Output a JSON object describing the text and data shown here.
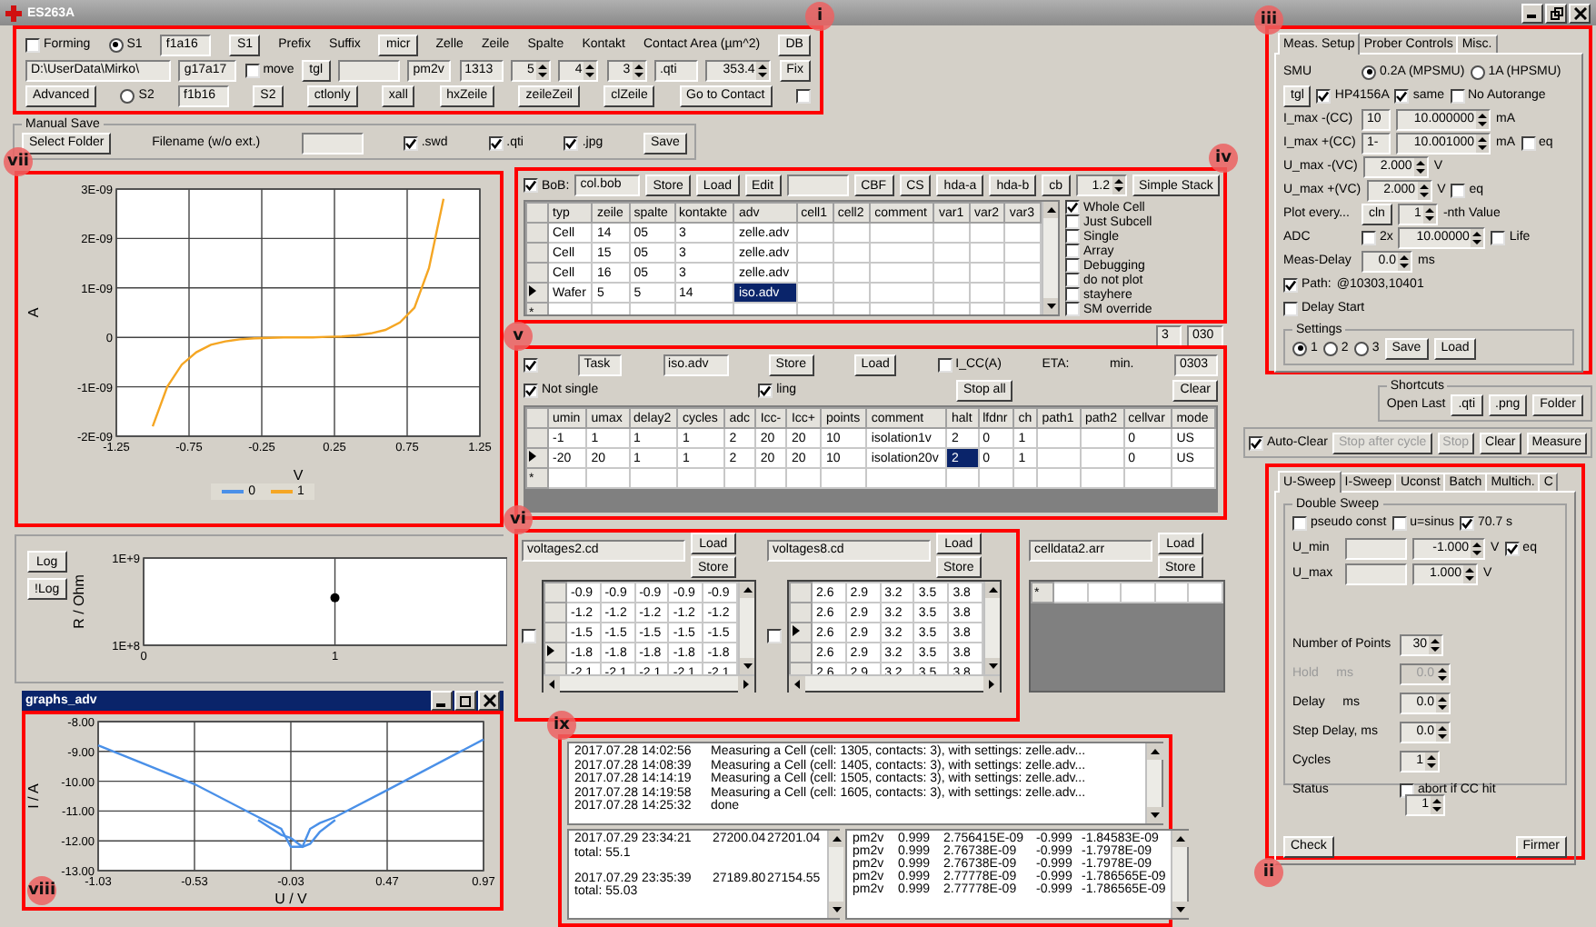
{
  "window": {
    "title": "ES263A"
  },
  "forming": {
    "annotation": "i",
    "rows": [
      {
        "items": [
          {
            "kind": "check",
            "text": "Forming",
            "checked": false
          },
          {
            "kind": "radio",
            "text": "S1",
            "selected": true
          },
          {
            "kind": "field",
            "value": "f1a16"
          },
          {
            "kind": "button",
            "text": "S1"
          },
          {
            "kind": "label",
            "text": "Prefix"
          },
          {
            "kind": "label",
            "text": "Suffix"
          },
          {
            "kind": "button",
            "text": "micr"
          },
          {
            "kind": "label",
            "text": "Zelle"
          },
          {
            "kind": "label",
            "text": "Zeile"
          },
          {
            "kind": "label",
            "text": "Spalte"
          },
          {
            "kind": "label",
            "text": "Kontakt"
          },
          {
            "kind": "label",
            "text": "Contact Area (µm^2)"
          },
          {
            "kind": "button",
            "text": "DB"
          }
        ]
      },
      {
        "items": [
          {
            "kind": "field",
            "value": "D:\\UserData\\Mirko\\"
          },
          {
            "kind": "field",
            "value": "g17a17"
          },
          {
            "kind": "check",
            "text": "move",
            "checked": false
          },
          {
            "kind": "button",
            "text": "tgl"
          },
          {
            "kind": "field"
          },
          {
            "kind": "field",
            "value": "pm2v"
          },
          {
            "kind": "field",
            "value": "1313"
          },
          {
            "kind": "spin",
            "value": "5"
          },
          {
            "kind": "spin",
            "value": "4"
          },
          {
            "kind": "spin",
            "value": "3"
          },
          {
            "kind": "field",
            "value": ".qti"
          },
          {
            "kind": "spin",
            "value": "353.4"
          },
          {
            "kind": "button",
            "text": "Fix"
          }
        ]
      },
      {
        "items": [
          {
            "kind": "button",
            "text": "Advanced"
          },
          {
            "kind": "radio",
            "text": "S2",
            "selected": false
          },
          {
            "kind": "field",
            "value": "f1b16"
          },
          {
            "kind": "button",
            "text": "S2"
          },
          {
            "kind": "button",
            "text": "ctlonly"
          },
          {
            "kind": "button",
            "text": "xall"
          },
          {
            "kind": "button",
            "text": "hxZeile"
          },
          {
            "kind": "button",
            "text": "zeileZeil"
          },
          {
            "kind": "button",
            "text": "clZeile"
          },
          {
            "kind": "button",
            "text": "Go to Contact"
          },
          {
            "kind": "check",
            "checked": false
          }
        ]
      }
    ]
  },
  "manual_save": {
    "title": "Manual Save",
    "items": [
      {
        "kind": "button",
        "text": "Select Folder"
      },
      {
        "kind": "label",
        "text": "Filename (w/o ext.)"
      },
      {
        "kind": "field"
      },
      {
        "kind": "check",
        "text": ".swd",
        "checked": true
      },
      {
        "kind": "check",
        "text": ".qti",
        "checked": true
      },
      {
        "kind": "check",
        "text": ".jpg",
        "checked": true
      },
      {
        "kind": "button",
        "text": "Save"
      }
    ]
  },
  "iv_curve": {
    "annotation": "vii",
    "chart_data": {
      "type": "line",
      "xlabel": "V",
      "ylabel": "A",
      "grid": true,
      "x": [
        -1,
        -0.9,
        -0.8,
        -0.7,
        -0.6,
        -0.5,
        -0.4,
        -0.3,
        -0.2,
        -0.1,
        0,
        0.1,
        0.2,
        0.3,
        0.4,
        0.5,
        0.6,
        0.7,
        0.8,
        0.9,
        1
      ],
      "xlim": [
        -1.25,
        1.25
      ],
      "ylim": [
        -2e-09,
        3e-09
      ],
      "xticks": [
        -1.25,
        -0.75,
        -0.25,
        0.25,
        0.75,
        1.25
      ],
      "yticks": [
        {
          "value": -2e-09,
          "label": "-2E-09"
        },
        {
          "value": -1e-09,
          "label": "-1E-09"
        },
        {
          "value": 0,
          "label": "0"
        },
        {
          "value": 1e-09,
          "label": "1E-09"
        },
        {
          "value": 2e-09,
          "label": "2E-09"
        },
        {
          "value": 3e-09,
          "label": "3E-09"
        }
      ],
      "series": [
        {
          "name": "0",
          "color": "#4a90e8",
          "values": [
            null,
            null,
            null,
            null,
            null,
            null,
            null,
            null,
            null,
            null,
            null,
            null,
            null,
            null,
            null,
            null,
            null,
            null,
            null,
            null,
            null
          ]
        },
        {
          "name": "1",
          "color": "#f5a623",
          "values": [
            -1.8e-09,
            -1e-09,
            -5.5e-10,
            -3e-10,
            -1.5e-10,
            -8e-11,
            -4e-11,
            -2e-11,
            -1e-11,
            0,
            0,
            0,
            1e-11,
            2e-11,
            4e-11,
            8e-11,
            1.5e-10,
            3e-10,
            6e-10,
            1.4e-09,
            2.8e-09
          ]
        }
      ]
    }
  },
  "resistance": {
    "buttons": [
      "Log",
      "!Log"
    ],
    "chart_data": {
      "type": "scatter",
      "ylabel": "R / Ohm",
      "grid": true,
      "x": [
        1
      ],
      "values": [
        590000000
      ],
      "xlim": [
        0,
        1.9
      ],
      "ylim": [
        100000000,
        1000000000
      ],
      "xticks": [
        0,
        1
      ],
      "yticks": [
        {
          "value": 100000000,
          "label": "1E+8"
        },
        {
          "value": 1000000000,
          "label": "1E+9"
        }
      ]
    }
  },
  "graphs_window": {
    "title": "graphs_adv",
    "annotation": "viii",
    "chart_data": {
      "type": "line",
      "xlabel": "U / V",
      "ylabel": "I / A",
      "grid": true,
      "x": [
        -1.03,
        -0.53,
        -0.2,
        -0.08,
        -0.03,
        0.03,
        0.07,
        0.12,
        0.2,
        0.47,
        0.97
      ],
      "xlim": [
        -1.03,
        0.97
      ],
      "ylim": [
        -13,
        -8
      ],
      "xticks": [
        -1.03,
        -0.53,
        -0.03,
        0.47,
        0.97
      ],
      "yticks": [
        {
          "value": -13,
          "label": "-13.00"
        },
        {
          "value": -12,
          "label": "-12.00"
        },
        {
          "value": -11,
          "label": "-11.00"
        },
        {
          "value": -10,
          "label": "-10.00"
        },
        {
          "value": -9,
          "label": "-9.00"
        },
        {
          "value": -8,
          "label": "-8.00"
        }
      ],
      "series": [
        {
          "color": "#4a90e8",
          "values": [
            -8.8,
            -10.1,
            -11.2,
            -11.6,
            -12.2,
            -12.2,
            -11.6,
            -11.4,
            -11.2,
            -10.3,
            -8.6
          ]
        },
        {
          "color": "#4a90e8",
          "values": [
            null,
            null,
            -11.3,
            -11.8,
            -11.9,
            -12.2,
            -12.1,
            -11.7,
            -11.3,
            null,
            null
          ]
        }
      ]
    }
  },
  "bob": {
    "annotation": "iv",
    "toolbar": [
      {
        "kind": "check",
        "text": "BoB:",
        "checked": true
      },
      {
        "kind": "field",
        "value": "col.bob"
      },
      {
        "kind": "button",
        "text": "Store"
      },
      {
        "kind": "button",
        "text": "Load"
      },
      {
        "kind": "button",
        "text": "Edit"
      },
      {
        "kind": "field"
      },
      {
        "kind": "button",
        "text": "CBF"
      },
      {
        "kind": "button",
        "text": "CS"
      },
      {
        "kind": "button",
        "text": "hda-a"
      },
      {
        "kind": "button",
        "text": "hda-b"
      },
      {
        "kind": "button",
        "text": "cb"
      },
      {
        "kind": "spin",
        "value": "1.2"
      },
      {
        "kind": "button",
        "text": "Simple Stack"
      }
    ],
    "table": {
      "columns": [
        "typ",
        "zeile",
        "spalte",
        "kontakte",
        "adv",
        "cell1",
        "cell2",
        "comment",
        "var1",
        "var2",
        "var3"
      ],
      "new_row_marker": "*",
      "rows": [
        {
          "current": false,
          "cells": [
            {
              "text": "Cell",
              "selected": false
            },
            {
              "text": "14",
              "selected": false
            },
            {
              "text": "05",
              "selected": false
            },
            {
              "text": "3",
              "selected": false
            },
            {
              "text": "zelle.adv",
              "selected": false
            },
            {
              "selected": false
            },
            {
              "selected": false
            },
            {
              "selected": false
            },
            {
              "selected": false
            },
            {
              "selected": false
            },
            {
              "selected": false
            }
          ]
        },
        {
          "current": false,
          "cells": [
            {
              "text": "Cell",
              "selected": false
            },
            {
              "text": "15",
              "selected": false
            },
            {
              "text": "05",
              "selected": false
            },
            {
              "text": "3",
              "selected": false
            },
            {
              "text": "zelle.adv",
              "selected": false
            },
            {
              "selected": false
            },
            {
              "selected": false
            },
            {
              "selected": false
            },
            {
              "selected": false
            },
            {
              "selected": false
            },
            {
              "selected": false
            }
          ]
        },
        {
          "current": false,
          "cells": [
            {
              "text": "Cell",
              "selected": false
            },
            {
              "text": "16",
              "selected": false
            },
            {
              "text": "05",
              "selected": false
            },
            {
              "text": "3",
              "selected": false
            },
            {
              "text": "zelle.adv",
              "selected": false
            },
            {
              "selected": false
            },
            {
              "selected": false
            },
            {
              "selected": false
            },
            {
              "selected": false
            },
            {
              "selected": false
            },
            {
              "selected": false
            }
          ]
        },
        {
          "current": true,
          "cells": [
            {
              "text": "Wafer",
              "selected": false
            },
            {
              "text": "5",
              "selected": false
            },
            {
              "text": "5",
              "selected": false
            },
            {
              "text": "14",
              "selected": false
            },
            {
              "text": "iso.adv",
              "selected": true
            },
            {
              "selected": false
            },
            {
              "selected": false
            },
            {
              "selected": false
            },
            {
              "selected": false
            },
            {
              "selected": false
            },
            {
              "selected": false
            }
          ]
        }
      ]
    },
    "options": [
      {
        "kind": "check",
        "text": "Whole Cell",
        "checked": true
      },
      {
        "kind": "check",
        "text": "Just Subcell",
        "checked": false
      },
      {
        "kind": "check",
        "text": "Single",
        "checked": false
      },
      {
        "kind": "check",
        "text": "Array",
        "checked": false
      },
      {
        "kind": "check",
        "text": "Debugging",
        "checked": false
      },
      {
        "kind": "check",
        "text": "do not plot",
        "checked": false
      },
      {
        "kind": "check",
        "text": "stayhere",
        "checked": false
      },
      {
        "kind": "check",
        "text": "SM override",
        "checked": false
      }
    ],
    "status": [
      {
        "kind": "field",
        "value": "3"
      },
      {
        "kind": "field",
        "value": "030"
      }
    ]
  },
  "task": {
    "annotation": "v",
    "rows": [
      {
        "items": [
          {
            "kind": "check",
            "checked": true
          },
          {
            "kind": "field",
            "value": "Task"
          },
          {
            "kind": "field",
            "value": "iso.adv"
          },
          {
            "kind": "button",
            "text": "Store"
          },
          {
            "kind": "button",
            "text": "Load"
          },
          {
            "kind": "check",
            "text": "I_CC(A)",
            "checked": false
          },
          {
            "kind": "label",
            "text": "ETA:"
          },
          {
            "kind": "label",
            "text": "min."
          },
          {
            "kind": "field",
            "value": "0303"
          }
        ]
      },
      {
        "items": [
          {
            "kind": "check",
            "text": "Not single",
            "checked": true
          },
          {
            "kind": "check",
            "text": "ling",
            "checked": true
          },
          {
            "kind": "button",
            "text": "Stop all"
          },
          {
            "kind": "button",
            "text": "Clear"
          }
        ]
      }
    ],
    "table": {
      "columns": [
        "umin",
        "umax",
        "delay2",
        "cycles",
        "adc",
        "Icc-",
        "Icc+",
        "points",
        "comment",
        "halt",
        "lfdnr",
        "ch",
        "path1",
        "path2",
        "cellvar",
        "mode"
      ],
      "new_row_marker": "*",
      "rows": [
        {
          "current": false,
          "cells": [
            {
              "text": "-1",
              "selected": false
            },
            {
              "text": "1",
              "selected": false
            },
            {
              "text": "1",
              "selected": false
            },
            {
              "text": "1",
              "selected": false
            },
            {
              "text": "2",
              "selected": false
            },
            {
              "text": "20",
              "selected": false
            },
            {
              "text": "20",
              "selected": false
            },
            {
              "text": "10",
              "selected": false
            },
            {
              "text": "isolation1v",
              "selected": false
            },
            {
              "text": "2",
              "selected": false
            },
            {
              "text": "0",
              "selected": false
            },
            {
              "text": "1",
              "selected": false
            },
            {
              "selected": false
            },
            {
              "selected": false
            },
            {
              "text": "0",
              "selected": false
            },
            {
              "text": "US",
              "selected": false
            }
          ]
        },
        {
          "current": true,
          "cells": [
            {
              "text": "-20",
              "selected": false
            },
            {
              "text": "20",
              "selected": false
            },
            {
              "text": "1",
              "selected": false
            },
            {
              "text": "1",
              "selected": false
            },
            {
              "text": "2",
              "selected": false
            },
            {
              "text": "20",
              "selected": false
            },
            {
              "text": "20",
              "selected": false
            },
            {
              "text": "10",
              "selected": false
            },
            {
              "text": "isolation20v",
              "selected": false
            },
            {
              "text": "2",
              "selected": true
            },
            {
              "text": "0",
              "selected": false
            },
            {
              "text": "1",
              "selected": false
            },
            {
              "selected": false
            },
            {
              "selected": false
            },
            {
              "text": "0",
              "selected": false
            },
            {
              "text": "US",
              "selected": false
            }
          ]
        }
      ]
    }
  },
  "voltages": {
    "annotation": "vi",
    "grids": [
      {
        "file": "voltages2.cd",
        "buttons": [
          "Load",
          "Store"
        ],
        "checked": false,
        "rows": [
          {
            "current": false,
            "cells": [
              "-0.9",
              "-0.9",
              "-0.9",
              "-0.9",
              "-0.9"
            ]
          },
          {
            "current": false,
            "cells": [
              "-1.2",
              "-1.2",
              "-1.2",
              "-1.2",
              "-1.2"
            ]
          },
          {
            "current": false,
            "cells": [
              "-1.5",
              "-1.5",
              "-1.5",
              "-1.5",
              "-1.5"
            ]
          },
          {
            "current": true,
            "cells": [
              "-1.8",
              "-1.8",
              "-1.8",
              "-1.8",
              "-1.8"
            ]
          },
          {
            "current": false,
            "cells": [
              "-2.1",
              "-2.1",
              "-2.1",
              "-2.1",
              "-2.1"
            ]
          }
        ]
      },
      {
        "file": "voltages8.cd",
        "buttons": [
          "Load",
          "Store"
        ],
        "checked": false,
        "rows": [
          {
            "current": false,
            "cells": [
              "2.6",
              "2.9",
              "3.2",
              "3.5",
              "3.8"
            ]
          },
          {
            "current": false,
            "cells": [
              "2.6",
              "2.9",
              "3.2",
              "3.5",
              "3.8"
            ]
          },
          {
            "current": true,
            "cells": [
              "2.6",
              "2.9",
              "3.2",
              "3.5",
              "3.8"
            ]
          },
          {
            "current": false,
            "cells": [
              "2.6",
              "2.9",
              "3.2",
              "3.5",
              "3.8"
            ]
          },
          {
            "current": false,
            "cells": [
              "2.6",
              "2.9",
              "3.2",
              "3.5",
              "3.8"
            ]
          }
        ]
      }
    ]
  },
  "celldata": {
    "file": "celldata2.arr",
    "buttons": [
      "Load",
      "Store"
    ],
    "new_row_marker": "*"
  },
  "log": {
    "annotation": "ix",
    "entries": [
      {
        "time": "2017.07.28 14:02:56",
        "message": "Measuring a Cell (cell: 1305, contacts: 3), with settings: zelle.adv..."
      },
      {
        "time": "2017.07.28 14:08:39",
        "message": "Measuring a Cell (cell: 1405, contacts: 3), with settings: zelle.adv..."
      },
      {
        "time": "2017.07.28 14:14:19",
        "message": "Measuring a Cell (cell: 1505, contacts: 3), with settings: zelle.adv..."
      },
      {
        "time": "2017.07.28 14:19:58",
        "message": "Measuring a Cell (cell: 1605, contacts: 3), with settings: zelle.adv..."
      },
      {
        "time": "2017.07.28 14:25:32",
        "message": "done"
      }
    ],
    "results": [
      {
        "time": "2017.07.29 23:34:21",
        "values": [
          "27200.04",
          "27201.04"
        ],
        "total": "total: 55.1"
      },
      {
        "time": "2017.07.29 23:35:39",
        "values": [
          "27189.80",
          "27154.55"
        ],
        "total": "total: 55.03"
      }
    ],
    "readings": [
      [
        "pm2v",
        "0.999",
        "2.756415E-09",
        "-0.999",
        "-1.84583E-09"
      ],
      [
        "pm2v",
        "0.999",
        "2.76738E-09",
        "-0.999",
        "-1.7978E-09"
      ],
      [
        "pm2v",
        "0.999",
        "2.76738E-09",
        "-0.999",
        "-1.7978E-09"
      ],
      [
        "pm2v",
        "0.999",
        "2.77778E-09",
        "-0.999",
        "-1.786565E-09"
      ],
      [
        "pm2v",
        "0.999",
        "2.77778E-09",
        "-0.999",
        "-1.786565E-09"
      ]
    ]
  },
  "meas_setup": {
    "annotation": "iii",
    "tabs": [
      {
        "label": "Meas. Setup",
        "selected": true
      },
      {
        "label": "Prober Controls",
        "selected": false
      },
      {
        "label": "Misc.",
        "selected": false
      }
    ],
    "rows": [
      {
        "items": [
          {
            "kind": "label",
            "text": "SMU"
          },
          {
            "kind": "radio",
            "text": "0.2A (MPSMU)",
            "selected": true
          },
          {
            "kind": "radio",
            "text": "1A (HPSMU)",
            "selected": false
          }
        ]
      },
      {
        "items": [
          {
            "kind": "button",
            "text": "tgl"
          },
          {
            "kind": "check",
            "text": "HP4156A",
            "checked": true
          },
          {
            "kind": "check",
            "text": "same",
            "checked": true
          },
          {
            "kind": "check",
            "text": "No Autorange",
            "checked": false
          }
        ]
      },
      {
        "items": [
          {
            "kind": "label",
            "text": "I_max -(CC)"
          },
          {
            "kind": "field",
            "value": "10"
          },
          {
            "kind": "spin",
            "value": "10.000000"
          },
          {
            "kind": "label",
            "text": "mA"
          }
        ]
      },
      {
        "items": [
          {
            "kind": "label",
            "text": "I_max +(CC)"
          },
          {
            "kind": "field",
            "value": "1-"
          },
          {
            "kind": "spin",
            "value": "10.001000"
          },
          {
            "kind": "label",
            "text": "mA"
          },
          {
            "kind": "check",
            "text": "eq",
            "checked": false
          }
        ]
      },
      {
        "items": [
          {
            "kind": "label",
            "text": "U_max -(VC)"
          },
          {
            "kind": "spin",
            "value": "2.000"
          },
          {
            "kind": "label",
            "text": "V"
          }
        ]
      },
      {
        "items": [
          {
            "kind": "label",
            "text": "U_max +(VC)"
          },
          {
            "kind": "spin",
            "value": "2.000"
          },
          {
            "kind": "label",
            "text": "V"
          },
          {
            "kind": "check",
            "text": "eq",
            "checked": false
          }
        ]
      },
      {
        "items": [
          {
            "kind": "label",
            "text": "Plot every..."
          },
          {
            "kind": "button",
            "text": "cln"
          },
          {
            "kind": "spin",
            "value": "1"
          },
          {
            "kind": "label",
            "text": "-nth Value"
          }
        ]
      },
      {
        "items": [
          {
            "kind": "label",
            "text": "ADC"
          },
          {
            "kind": "check",
            "text": "2x",
            "checked": false
          },
          {
            "kind": "spin",
            "value": "10.00000"
          },
          {
            "kind": "check",
            "text": "Life",
            "checked": false
          }
        ]
      },
      {
        "items": [
          {
            "kind": "label",
            "text": "Meas-Delay"
          },
          {
            "kind": "spin",
            "value": "0.0"
          },
          {
            "kind": "label",
            "text": "ms"
          }
        ]
      },
      {
        "items": [
          {
            "kind": "check",
            "text": "Path:",
            "checked": true
          },
          {
            "kind": "label",
            "text": "@10303,10401"
          }
        ]
      },
      {
        "items": [
          {
            "kind": "check",
            "text": "Delay Start",
            "checked": false
          }
        ]
      }
    ],
    "settings": {
      "title": "Settings",
      "items": [
        {
          "kind": "radio",
          "text": "1",
          "selected": true
        },
        {
          "kind": "radio",
          "text": "2",
          "selected": false
        },
        {
          "kind": "radio",
          "text": "3",
          "selected": false
        },
        {
          "kind": "button",
          "text": "Save"
        },
        {
          "kind": "button",
          "text": "Load"
        }
      ]
    }
  },
  "shortcuts": {
    "title": "Shortcuts",
    "items": [
      {
        "kind": "label",
        "text": "Open Last"
      },
      {
        "kind": "button",
        "text": ".qti"
      },
      {
        "kind": "button",
        "text": ".png"
      },
      {
        "kind": "button",
        "text": "Folder"
      }
    ]
  },
  "controls": [
    {
      "kind": "check",
      "text": "Auto-Clear",
      "checked": true,
      "disabled": false
    },
    {
      "kind": "button",
      "text": "Stop after cycle",
      "disabled": true
    },
    {
      "kind": "button",
      "text": "Stop",
      "disabled": true
    },
    {
      "kind": "button",
      "text": "Clear",
      "disabled": false
    },
    {
      "kind": "button",
      "text": "Measure",
      "disabled": false
    }
  ],
  "sweep": {
    "annotation": "ii",
    "tabs": [
      {
        "label": "U-Sweep",
        "selected": true
      },
      {
        "label": "I-Sweep",
        "selected": false
      },
      {
        "label": "Uconst",
        "selected": false
      },
      {
        "label": "Batch",
        "selected": false
      },
      {
        "label": "Multich.",
        "selected": false
      },
      {
        "label": "C",
        "selected": false
      }
    ],
    "group": "Double Sweep",
    "rows": [
      {
        "items": [
          {
            "kind": "check",
            "text": "pseudo const",
            "checked": false
          },
          {
            "kind": "check",
            "text": "u=sinus",
            "checked": false
          },
          {
            "kind": "check",
            "text": "70.7 s",
            "checked": true
          }
        ]
      },
      {
        "items": [
          {
            "kind": "label",
            "text": "U_min"
          },
          {
            "kind": "field"
          },
          {
            "kind": "spin",
            "value": "-1.000"
          },
          {
            "kind": "label",
            "text": "V"
          },
          {
            "kind": "check",
            "text": "eq",
            "checked": true
          }
        ]
      },
      {
        "items": [
          {
            "kind": "label",
            "text": "U_max"
          },
          {
            "kind": "field"
          },
          {
            "kind": "spin",
            "value": "1.000"
          },
          {
            "kind": "label",
            "text": "V"
          }
        ]
      }
    ],
    "rows2": [
      {
        "items": [
          {
            "kind": "label",
            "text": "Number of Points"
          },
          {
            "kind": "spin",
            "value": "30"
          }
        ]
      },
      {
        "items": [
          {
            "kind": "label",
            "text": "Hold     ms",
            "disabled": true
          },
          {
            "kind": "spin",
            "value": "0.0",
            "disabled": true
          }
        ]
      },
      {
        "items": [
          {
            "kind": "label",
            "text": "Delay     ms"
          },
          {
            "kind": "spin",
            "value": "0.0"
          }
        ]
      },
      {
        "items": [
          {
            "kind": "label",
            "text": "Step Delay, ms"
          },
          {
            "kind": "spin",
            "value": "0.0"
          }
        ]
      },
      {
        "items": [
          {
            "kind": "label",
            "text": "Cycles"
          },
          {
            "kind": "spin",
            "value": "1"
          }
        ]
      },
      {
        "items": [
          {
            "kind": "label",
            "text": "Status"
          },
          {
            "kind": "check",
            "text": "abort if CC hit",
            "checked": false
          }
        ]
      }
    ],
    "counter": {
      "kind": "spin",
      "value": "1"
    },
    "buttons": [
      "Check",
      "Firmer"
    ]
  }
}
